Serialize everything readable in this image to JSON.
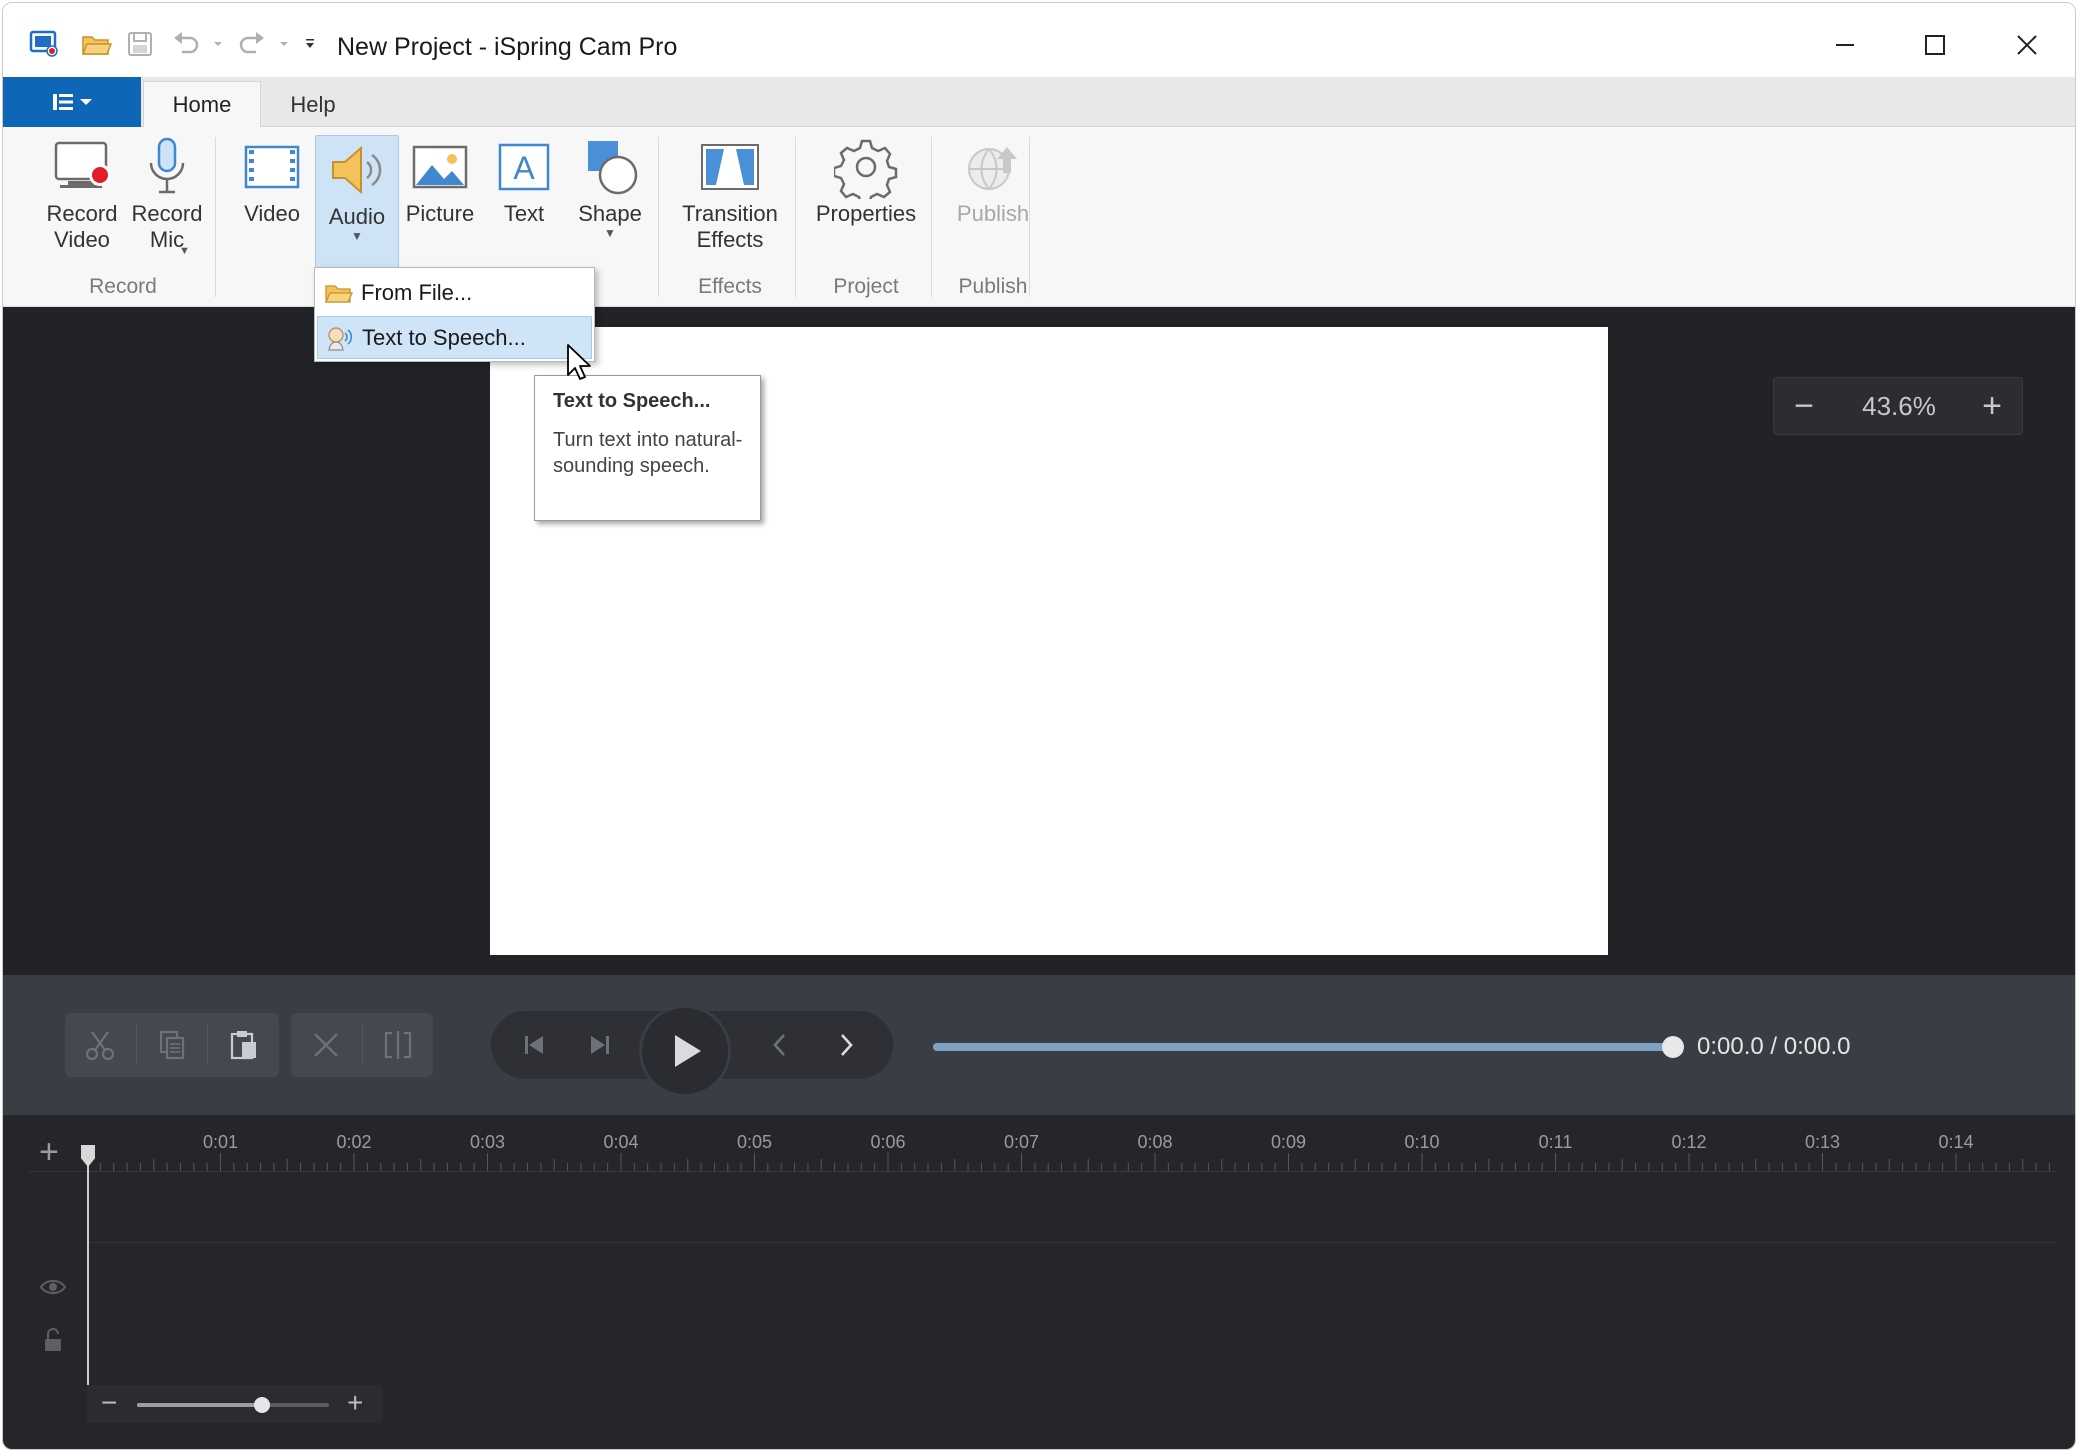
{
  "window": {
    "title": "New Project - iSpring Cam Pro"
  },
  "titlebar": {
    "quick_access": [
      "app-icon",
      "open-folder-icon",
      "save-icon",
      "undo-icon",
      "redo-icon",
      "customize-icon"
    ],
    "controls": [
      "minimize-icon",
      "maximize-icon",
      "close-icon"
    ]
  },
  "tabs": {
    "home": "Home",
    "help": "Help"
  },
  "ribbon": {
    "record_video": "Record\nVideo",
    "record_mic": "Record\nMic",
    "video": "Video",
    "audio": "Audio",
    "picture": "Picture",
    "text": "Text",
    "shape": "Shape",
    "transition_effects": "Transition\nEffects",
    "properties": "Properties",
    "publish": "Publish",
    "groups": {
      "record": "Record",
      "effects": "Effects",
      "project": "Project",
      "publish": "Publish"
    }
  },
  "audio_menu": {
    "from_file": "From File...",
    "text_to_speech": "Text to Speech..."
  },
  "tooltip": {
    "title": "Text to Speech...",
    "body": "Turn text into natural-sounding speech."
  },
  "stage": {
    "zoom_value": "43.6%",
    "zoom_minus": "−",
    "zoom_plus": "+"
  },
  "playback": {
    "time": "0:00.0 / 0:00.0",
    "progress": 1.0
  },
  "timeline": {
    "add": "+",
    "ticks": [
      "0:01",
      "0:02",
      "0:03",
      "0:04",
      "0:05",
      "0:06",
      "0:07",
      "0:08",
      "0:09",
      "0:10",
      "0:11",
      "0:12",
      "0:13",
      "0:14"
    ],
    "zoom_minus": "−",
    "zoom_plus": "+",
    "zoom_level": 0.65
  },
  "colors": {
    "accent": "#0e66b8",
    "highlight": "#cfe4f7",
    "stage_bg": "#222326",
    "record_red": "#e11d2a"
  }
}
